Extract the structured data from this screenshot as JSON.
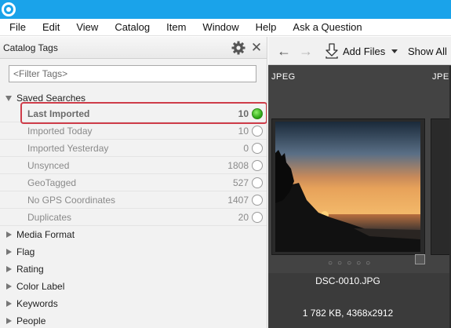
{
  "menu": {
    "file": "File",
    "edit": "Edit",
    "view": "View",
    "catalog": "Catalog",
    "item": "Item",
    "window": "Window",
    "help": "Help",
    "ask": "Ask a Question"
  },
  "left_panel": {
    "title": "Catalog Tags",
    "filter_placeholder": "<Filter Tags>",
    "saved_searches": {
      "label": "Saved Searches",
      "items": [
        {
          "label": "Last Imported",
          "count": "10",
          "active": true
        },
        {
          "label": "Imported Today",
          "count": "10",
          "active": false
        },
        {
          "label": "Imported Yesterday",
          "count": "0",
          "active": false
        },
        {
          "label": "Unsynced",
          "count": "1808",
          "active": false
        },
        {
          "label": "GeoTagged",
          "count": "527",
          "active": false
        },
        {
          "label": "No GPS Coordinates",
          "count": "1407",
          "active": false
        },
        {
          "label": "Duplicates",
          "count": "20",
          "active": false
        }
      ]
    },
    "sections": [
      {
        "label": "Media Format"
      },
      {
        "label": "Flag"
      },
      {
        "label": "Rating"
      },
      {
        "label": "Color Label"
      },
      {
        "label": "Keywords"
      },
      {
        "label": "People"
      }
    ]
  },
  "toolbar": {
    "add_files": "Add Files",
    "show_all": "Show All"
  },
  "grid": {
    "columns": [
      {
        "label": "JPEG"
      },
      {
        "label": "JPEG"
      }
    ],
    "selected_file": {
      "name": "DSC-0010.JPG",
      "info": "1 782 KB, 4368x2912"
    },
    "pager_dots": "○○○○○"
  },
  "colors": {
    "titlebar": "#1aa3ea",
    "highlight": "#cf3d4a",
    "active_radio": "#2ea616",
    "grid_background": "#434343"
  }
}
